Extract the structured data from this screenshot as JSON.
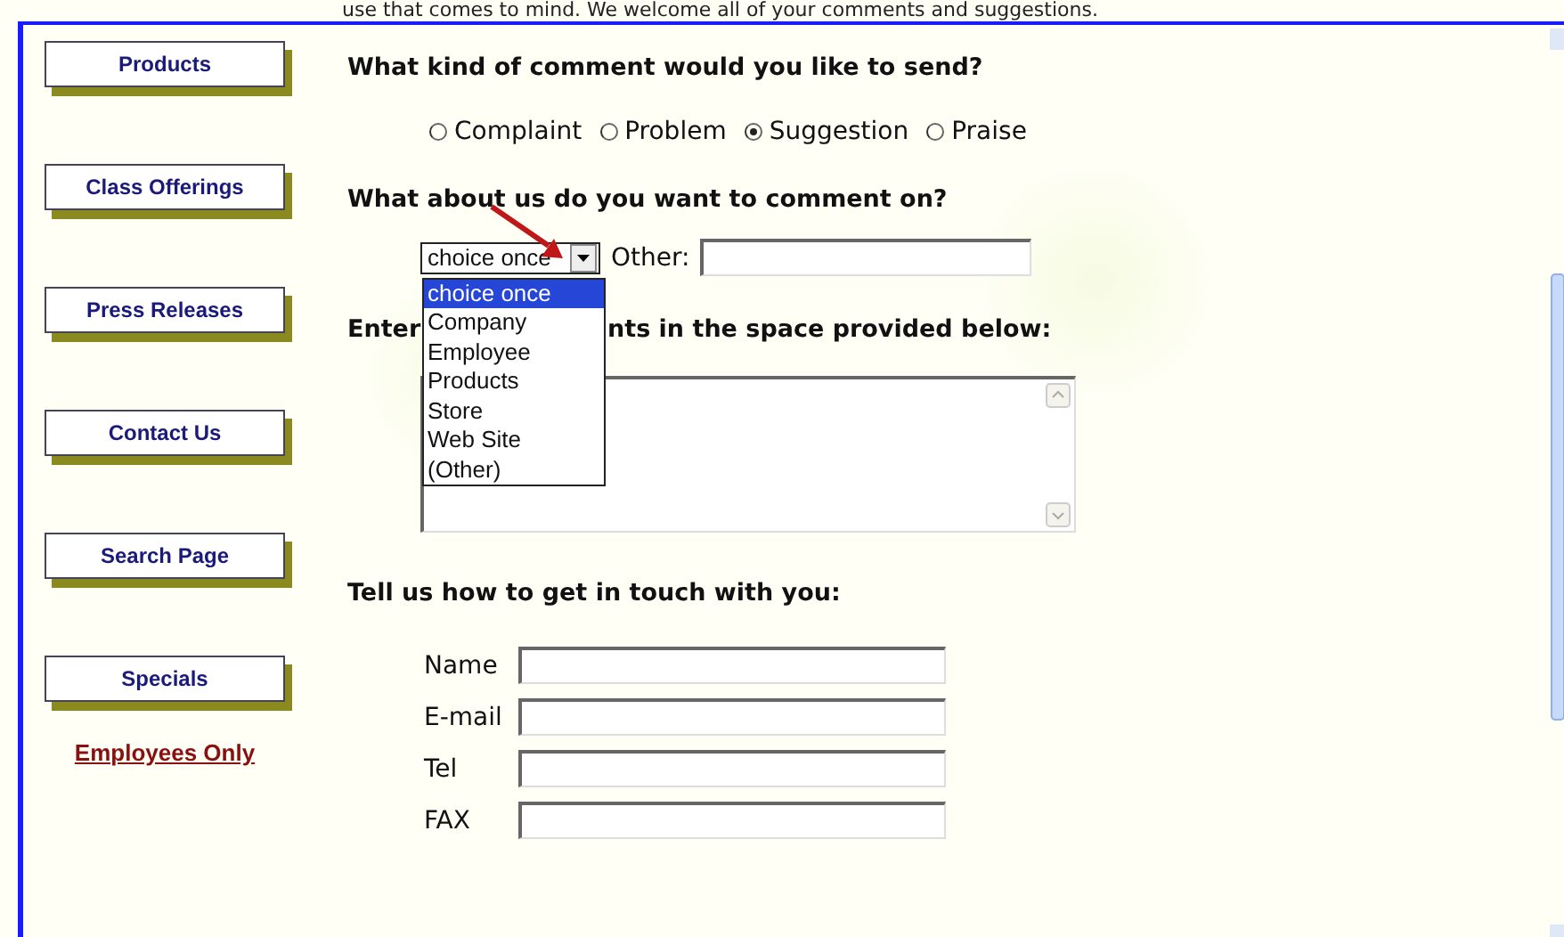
{
  "intro_text": "use that comes to mind. We welcome all of your comments and suggestions.",
  "sidebar": {
    "items": [
      {
        "label": "Products"
      },
      {
        "label": "Class Offerings"
      },
      {
        "label": "Press Releases"
      },
      {
        "label": "Contact Us"
      },
      {
        "label": "Search Page"
      },
      {
        "label": "Specials"
      }
    ],
    "link": "Employees Only"
  },
  "comment_type": {
    "heading": "What kind of comment would you like to send?",
    "options": [
      {
        "label": "Complaint",
        "selected": false
      },
      {
        "label": "Problem",
        "selected": false
      },
      {
        "label": "Suggestion",
        "selected": true
      },
      {
        "label": "Praise",
        "selected": false
      }
    ]
  },
  "comment_subject": {
    "heading": "What about us do you want to comment on?",
    "select": {
      "value": "choice once",
      "expanded": true,
      "options": [
        {
          "label": "choice once",
          "selected": true
        },
        {
          "label": "Company",
          "selected": false
        },
        {
          "label": "Employee",
          "selected": false
        },
        {
          "label": "Products",
          "selected": false
        },
        {
          "label": "Store",
          "selected": false
        },
        {
          "label": "Web Site",
          "selected": false
        },
        {
          "label": "(Other)",
          "selected": false
        }
      ]
    },
    "other_label": "Other:"
  },
  "comments": {
    "heading_parts": [
      "Enter",
      "nts in the space provided below:"
    ]
  },
  "contact": {
    "heading": "Tell us how to get in touch with you:",
    "fields": [
      {
        "label": "Name"
      },
      {
        "label": "E-mail"
      },
      {
        "label": "Tel"
      },
      {
        "label": "FAX"
      }
    ]
  }
}
